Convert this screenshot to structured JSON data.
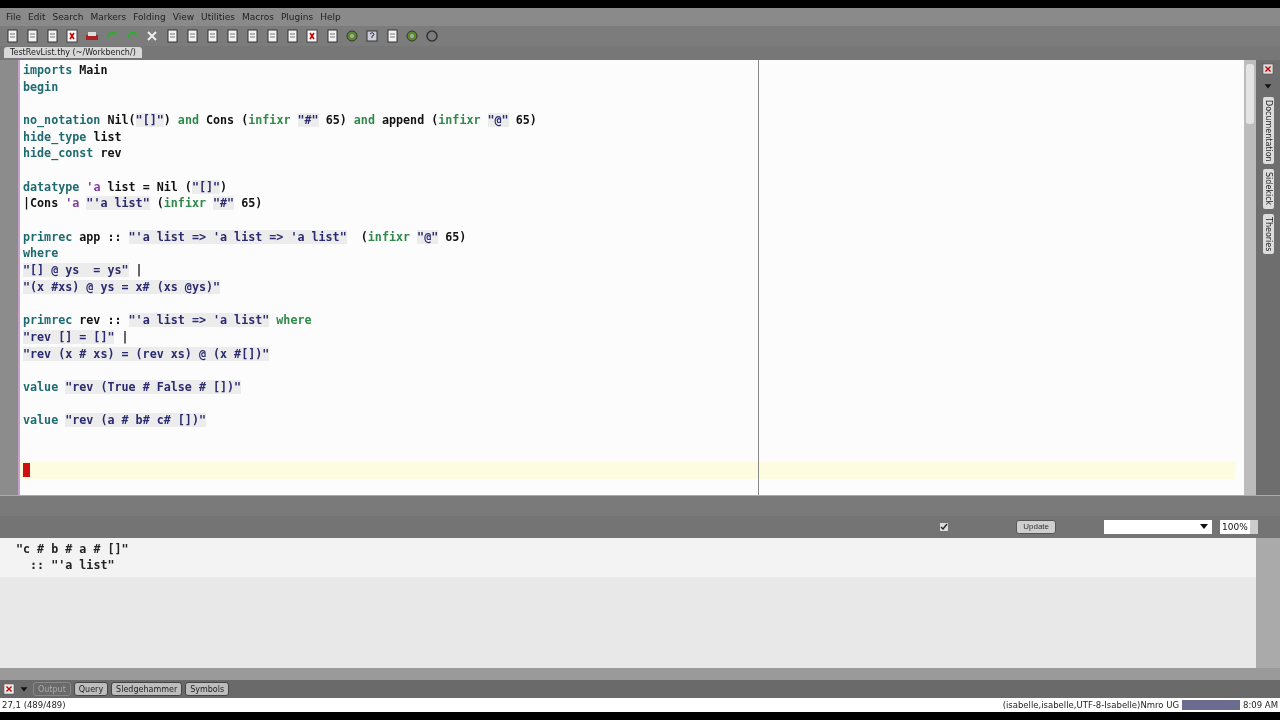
{
  "menu": [
    "File",
    "Edit",
    "Search",
    "Markers",
    "Folding",
    "View",
    "Utilities",
    "Macros",
    "Plugins",
    "Help"
  ],
  "buffer_tab": {
    "label": "TestRevList.thy (~/Workbench/)"
  },
  "editor": {
    "blocks": [
      [
        [
          {
            "text": "imports ",
            "kind": "keyword"
          },
          {
            "text": "Main",
            "kind": "plain"
          }
        ],
        [
          {
            "text": "begin",
            "kind": "keyword"
          }
        ]
      ],
      [
        [
          {
            "text": "no_notation ",
            "kind": "keyword"
          },
          {
            "text": "Nil(",
            "kind": "plain"
          },
          {
            "text": "\"[]\"",
            "kind": "string"
          },
          {
            "text": ") ",
            "kind": "plain"
          },
          {
            "text": "and ",
            "kind": "minor"
          },
          {
            "text": "Cons (",
            "kind": "plain"
          },
          {
            "text": "infixr ",
            "kind": "minor"
          },
          {
            "text": "\"#\"",
            "kind": "string"
          },
          {
            "text": " 65) ",
            "kind": "plain"
          },
          {
            "text": "and ",
            "kind": "minor"
          },
          {
            "text": "append (",
            "kind": "plain"
          },
          {
            "text": "infixr ",
            "kind": "minor"
          },
          {
            "text": "\"@\"",
            "kind": "string"
          },
          {
            "text": " 65)",
            "kind": "plain"
          }
        ],
        [
          {
            "text": "hide_type ",
            "kind": "keyword"
          },
          {
            "text": "list",
            "kind": "plain"
          }
        ],
        [
          {
            "text": "hide_const ",
            "kind": "keyword"
          },
          {
            "text": "rev",
            "kind": "plain"
          }
        ]
      ],
      [
        [
          {
            "text": "datatype ",
            "kind": "keyword"
          },
          {
            "text": "'a",
            "kind": "tfree"
          },
          {
            "text": " list = Nil (",
            "kind": "plain"
          },
          {
            "text": "\"[]\"",
            "kind": "string"
          },
          {
            "text": ")",
            "kind": "plain"
          }
        ],
        [
          {
            "text": "|Cons ",
            "kind": "plain"
          },
          {
            "text": "'a ",
            "kind": "tfree"
          },
          {
            "text": "\"'a list\"",
            "kind": "string"
          },
          {
            "text": " (",
            "kind": "plain"
          },
          {
            "text": "infixr ",
            "kind": "minor"
          },
          {
            "text": "\"#\"",
            "kind": "string"
          },
          {
            "text": " 65)",
            "kind": "plain"
          }
        ]
      ],
      [
        [
          {
            "text": "primrec ",
            "kind": "keyword"
          },
          {
            "text": "app :: ",
            "kind": "plain"
          },
          {
            "text": "\"'a list => 'a list => 'a list\"",
            "kind": "string"
          },
          {
            "text": "  (",
            "kind": "plain"
          },
          {
            "text": "infixr ",
            "kind": "minor"
          },
          {
            "text": "\"@\"",
            "kind": "string"
          },
          {
            "text": " 65)",
            "kind": "plain"
          }
        ],
        [
          {
            "text": "where",
            "kind": "keyword"
          }
        ],
        [
          {
            "text": "\"[] @ ys  = ys\"",
            "kind": "string"
          },
          {
            "text": " |",
            "kind": "plain"
          }
        ],
        [
          {
            "text": "\"(x #xs) @ ys = x# (xs @ys)\"",
            "kind": "string"
          }
        ]
      ],
      [
        [
          {
            "text": "primrec ",
            "kind": "keyword"
          },
          {
            "text": "rev :: ",
            "kind": "plain"
          },
          {
            "text": "\"'a list => 'a list\"",
            "kind": "string"
          },
          {
            "text": " where",
            "kind": "minor"
          }
        ],
        [
          {
            "text": "\"rev [] = []\"",
            "kind": "string"
          },
          {
            "text": " |",
            "kind": "plain"
          }
        ],
        [
          {
            "text": "\"rev (x # xs) = (rev xs) @ (x #[])\"",
            "kind": "string"
          }
        ]
      ],
      [
        [
          {
            "text": "value ",
            "kind": "keyword"
          },
          {
            "text": "\"rev (True # False # [])\"",
            "kind": "string"
          }
        ]
      ],
      [
        [
          {
            "text": "value ",
            "kind": "keyword"
          },
          {
            "text": "\"rev (a # b# c# [])\"",
            "kind": "string"
          }
        ]
      ]
    ]
  },
  "dock_tabs": [
    "Documentation",
    "Sidekick",
    "Theories"
  ],
  "output_toolbar": {
    "auto_update": {
      "checked": true
    },
    "update_button": "Update",
    "zoom": "100%"
  },
  "output": [
    "\"c # b # a # []\"",
    "  :: \"'a list\""
  ],
  "bottom_tabs": [
    {
      "label": "Output",
      "selected": true
    },
    {
      "label": "Query",
      "selected": false
    },
    {
      "label": "Sledgehammer",
      "selected": false
    },
    {
      "label": "Symbols",
      "selected": false
    }
  ],
  "status_bar": {
    "position": "27,1 (489/489)",
    "modes": "(isabelle,isabelle,UTF-8-Isabelle)Nmro UG",
    "clock": "8:09 AM"
  }
}
